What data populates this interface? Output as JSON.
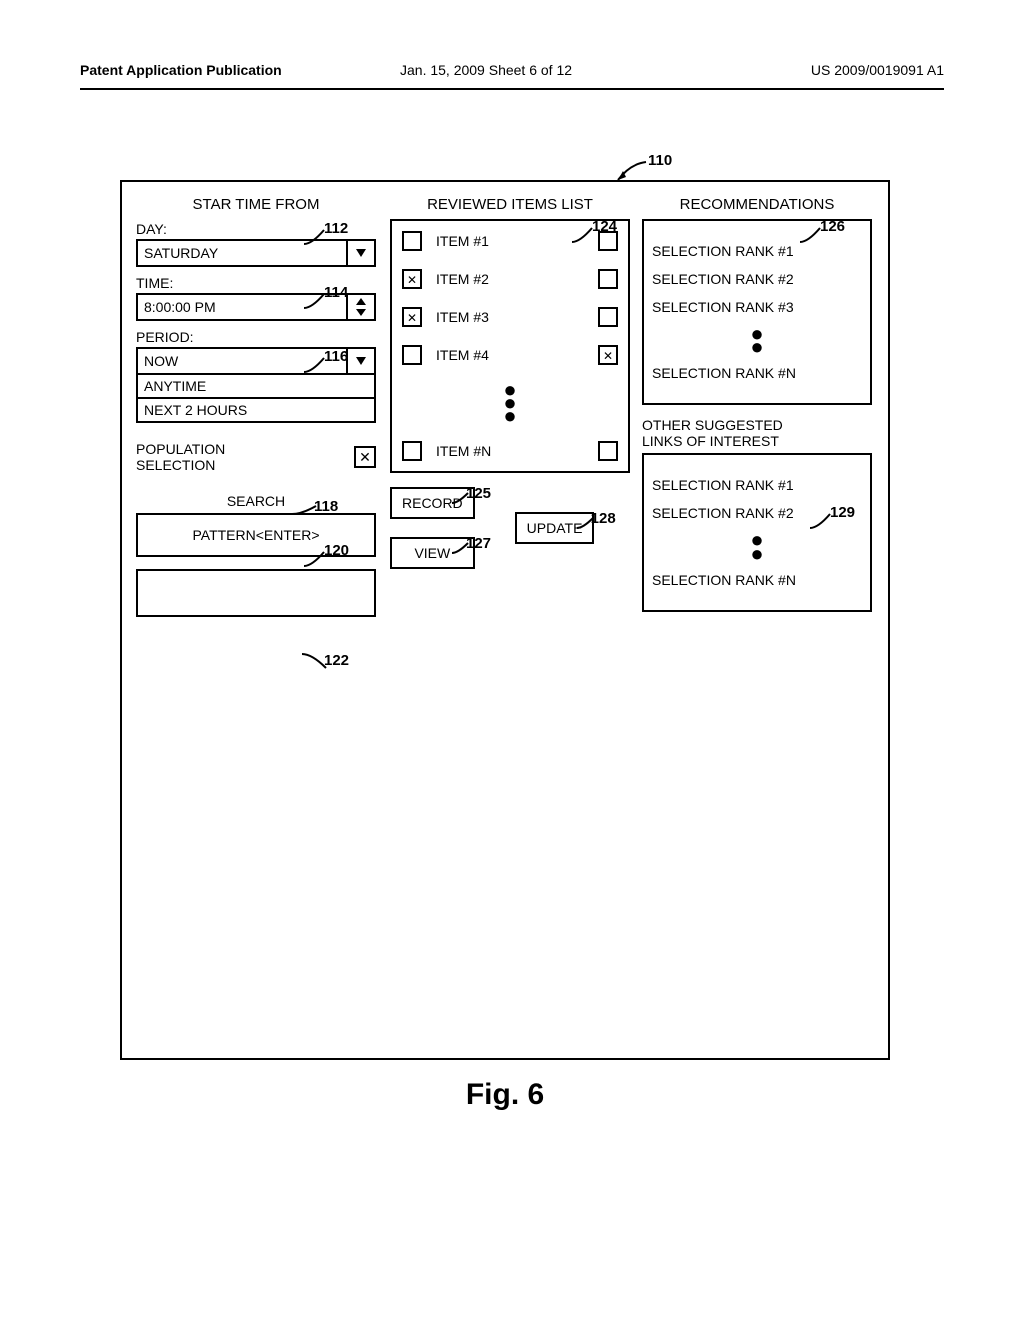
{
  "header": {
    "left": "Patent Application Publication",
    "center": "Jan. 15, 2009  Sheet 6 of 12",
    "right": "US 2009/0019091 A1"
  },
  "figure": {
    "caption": "Fig. 6",
    "mainRef": "110"
  },
  "left": {
    "title": "STAR TIME FROM",
    "dayLabel": "DAY:",
    "dayValue": "SATURDAY",
    "dayRef": "112",
    "timeLabel": "TIME:",
    "timeValue": "8:00:00 PM",
    "timeRef": "114",
    "periodLabel": "PERIOD:",
    "periodValue": "NOW",
    "periodOpt1": "ANYTIME",
    "periodOpt2": "NEXT 2 HOURS",
    "periodRef": "116",
    "popLabel1": "POPULATION",
    "popLabel2": "SELECTION",
    "popRef": "118",
    "searchLabel": "SEARCH",
    "searchRef": "120",
    "patternLabel": "PATTERN<ENTER>",
    "emptyRef": "122"
  },
  "mid": {
    "title": "REVIEWED ITEMS LIST",
    "ref": "124",
    "items": [
      {
        "label": "ITEM #1",
        "l": false,
        "r": false
      },
      {
        "label": "ITEM #2",
        "l": true,
        "r": false
      },
      {
        "label": "ITEM #3",
        "l": true,
        "r": false
      },
      {
        "label": "ITEM #4",
        "l": false,
        "r": true
      }
    ],
    "lastItem": {
      "label": "ITEM #N",
      "l": false,
      "r": false
    },
    "recordLabel": "RECORD",
    "recordRef": "125",
    "viewLabel": "VIEW",
    "viewRef": "127",
    "updateLabel": "UPDATE",
    "updateRef": "128"
  },
  "right": {
    "title": "RECOMMENDATIONS",
    "ref": "126",
    "ranks": [
      "SELECTION RANK #1",
      "SELECTION RANK #2",
      "SELECTION RANK #3"
    ],
    "rankLast": "SELECTION RANK #N",
    "linksTitle1": "OTHER SUGGESTED",
    "linksTitle2": "LINKS OF INTEREST",
    "linksRef": "129",
    "linkRanks": [
      "SELECTION RANK #1",
      "SELECTION RANK #2"
    ],
    "linkRankLast": "SELECTION RANK #N"
  }
}
